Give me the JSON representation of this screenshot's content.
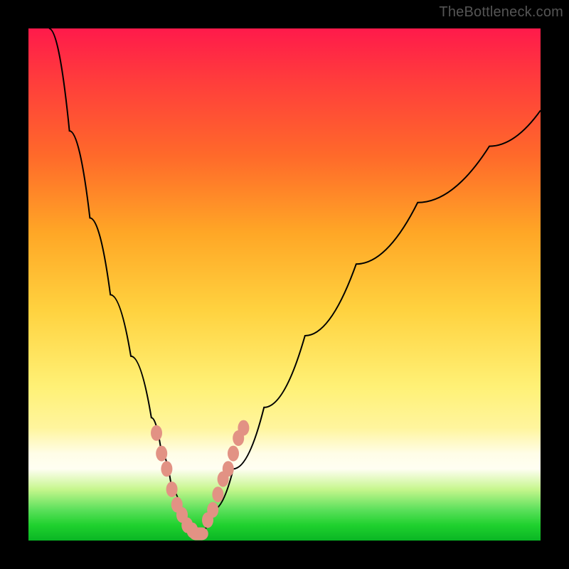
{
  "watermark": "TheBottleneck.com",
  "chart_data": {
    "type": "line",
    "title": "",
    "xlabel": "",
    "ylabel": "",
    "xlim": [
      0,
      100
    ],
    "ylim": [
      0,
      100
    ],
    "grid": false,
    "legend": false,
    "series": [
      {
        "name": "bottleneck-curve",
        "x": [
          4,
          8,
          12,
          16,
          20,
          24,
          26,
          28,
          30,
          32,
          33,
          34,
          36,
          40,
          46,
          54,
          64,
          76,
          90,
          100
        ],
        "y": [
          100,
          80,
          63,
          48,
          36,
          24,
          17,
          10,
          5,
          2,
          1,
          2,
          6,
          14,
          26,
          40,
          54,
          66,
          77,
          84
        ]
      }
    ],
    "markers": {
      "name": "data-beads",
      "color": "#e29284",
      "left_branch": [
        {
          "x": 25,
          "y": 21
        },
        {
          "x": 26,
          "y": 17
        },
        {
          "x": 27,
          "y": 14
        },
        {
          "x": 28,
          "y": 10
        },
        {
          "x": 29,
          "y": 7
        },
        {
          "x": 30,
          "y": 5
        },
        {
          "x": 31,
          "y": 3
        },
        {
          "x": 32,
          "y": 2
        }
      ],
      "valley": [
        {
          "x": 32.5,
          "y": 1.5
        },
        {
          "x": 33,
          "y": 1
        },
        {
          "x": 33.5,
          "y": 1.2
        },
        {
          "x": 34,
          "y": 1.6
        }
      ],
      "right_branch": [
        {
          "x": 35,
          "y": 4
        },
        {
          "x": 36,
          "y": 6
        },
        {
          "x": 37,
          "y": 9
        },
        {
          "x": 38,
          "y": 12
        },
        {
          "x": 39,
          "y": 14
        },
        {
          "x": 40,
          "y": 17
        },
        {
          "x": 41,
          "y": 20
        },
        {
          "x": 42,
          "y": 22
        }
      ]
    },
    "background_gradient": {
      "stops": [
        {
          "pos": 0,
          "color": "#ff1a4b"
        },
        {
          "pos": 25,
          "color": "#ff6a2a"
        },
        {
          "pos": 55,
          "color": "#ffd23f"
        },
        {
          "pos": 83,
          "color": "#fffde7"
        },
        {
          "pos": 92,
          "color": "#5be05b"
        },
        {
          "pos": 100,
          "color": "#0ab624"
        }
      ]
    }
  }
}
